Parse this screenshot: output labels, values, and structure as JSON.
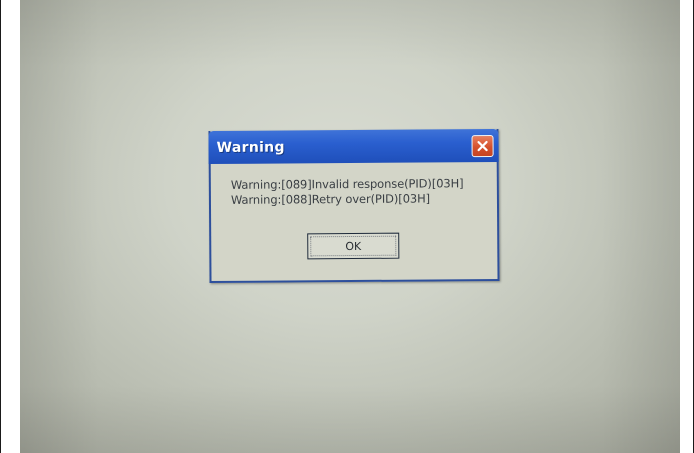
{
  "dialog": {
    "title": "Warning",
    "messages": [
      "Warning:[089]Invalid response(PID)[03H]",
      "Warning:[088]Retry over(PID)[03H]"
    ],
    "ok_label": "OK",
    "close_icon": "close-icon"
  },
  "colors": {
    "titlebar": "#2a5fcf",
    "close_button": "#d5512d",
    "dialog_body": "#d3d5c8",
    "screen_background": "#cfd3c8"
  }
}
